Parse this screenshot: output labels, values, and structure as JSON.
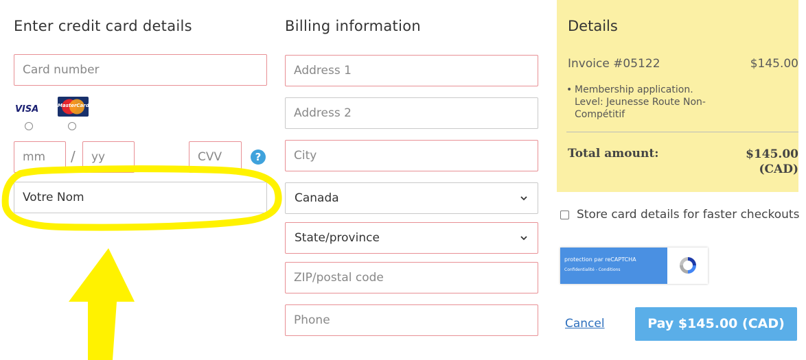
{
  "card_section": {
    "title": "Enter credit card details",
    "card_number_placeholder": "Card number",
    "brands": [
      {
        "label": "VISA",
        "icon": "visa-logo"
      },
      {
        "label": "MasterCard",
        "icon": "mastercard-logo"
      }
    ],
    "month_placeholder": "mm",
    "separator": "/",
    "year_placeholder": "yy",
    "cvv_placeholder": "CVV",
    "help_icon": "?",
    "name_value": "Votre Nom"
  },
  "billing_section": {
    "title": "Billing information",
    "address1_placeholder": "Address 1",
    "address2_placeholder": "Address 2",
    "city_placeholder": "City",
    "country_value": "Canada",
    "state_value": "State/province",
    "zip_placeholder": "ZIP/postal code",
    "phone_placeholder": "Phone"
  },
  "details": {
    "title": "Details",
    "invoice_label": "Invoice #05122",
    "invoice_amount": "$145.00",
    "bullet_mark": "•",
    "line_item": "Membership application. Level: Jeunesse Route Non-Compétitif",
    "total_label": "Total amount:",
    "total_amount": "$145.00",
    "total_currency": "(CAD)"
  },
  "store_card_label": "Store card details for faster checkouts",
  "recaptcha": {
    "title": "protection par reCAPTCHA",
    "links": "Confidentialité - Conditions"
  },
  "actions": {
    "cancel_label": "Cancel",
    "pay_label": "Pay $145.00 (CAD)"
  },
  "colors": {
    "field_border": "#e88f94",
    "details_bg": "#fbf0a5",
    "pay_button": "#5aaee8",
    "highlight_annotation": "#fff200",
    "help_icon": "#3fa2dc"
  }
}
